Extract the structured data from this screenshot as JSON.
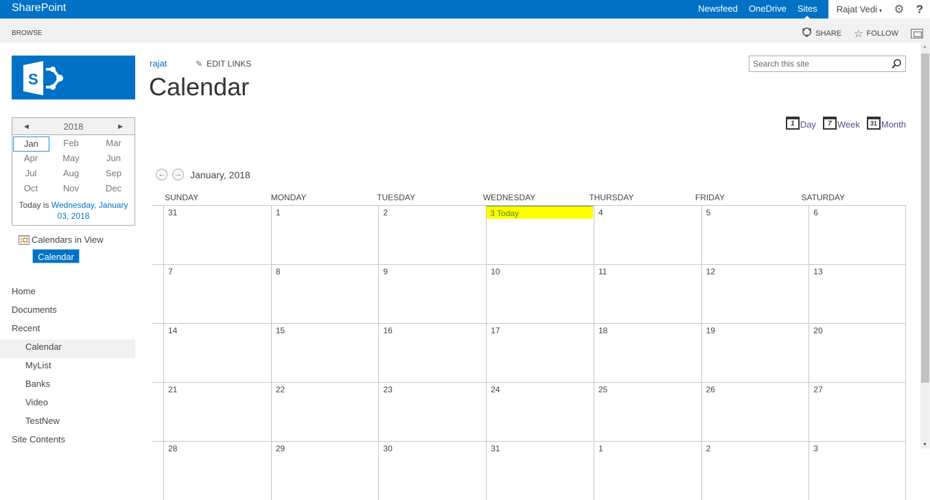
{
  "suitebar": {
    "brand": "SharePoint",
    "links": [
      {
        "label": "Newsfeed",
        "active": false
      },
      {
        "label": "OneDrive",
        "active": false
      },
      {
        "label": "Sites",
        "active": true
      }
    ],
    "user": "Rajat Vedi",
    "user_caret": "▾",
    "settings_icon": "⚙",
    "help_icon": "?"
  },
  "ribbon": {
    "tab": "BROWSE",
    "share_label": "SHARE",
    "follow_label": "FOLLOW"
  },
  "header": {
    "breadcrumb": "rajat",
    "edit_links": "EDIT LINKS",
    "title": "Calendar",
    "search_placeholder": "Search this site"
  },
  "views": [
    {
      "label": "Day",
      "icon_text": "1"
    },
    {
      "label": "Week",
      "icon_text": "7"
    },
    {
      "label": "Month",
      "icon_text": "31"
    }
  ],
  "datepicker": {
    "year": "2018",
    "prev_icon": "◀",
    "next_icon": "▶",
    "months": [
      "Jan",
      "Feb",
      "Mar",
      "Apr",
      "May",
      "Jun",
      "Jul",
      "Aug",
      "Sep",
      "Oct",
      "Nov",
      "Dec"
    ],
    "selected_month": "Jan",
    "today_prefix": "Today is ",
    "today_link": "Wednesday, January 03, 2018"
  },
  "calendars_in_view": {
    "label": "Calendars in View",
    "badge": "Calendar"
  },
  "quicklaunch": [
    {
      "label": "Home",
      "sub": false,
      "selected": false
    },
    {
      "label": "Documents",
      "sub": false,
      "selected": false
    },
    {
      "label": "Recent",
      "sub": false,
      "selected": false
    },
    {
      "label": "Calendar",
      "sub": true,
      "selected": true
    },
    {
      "label": "MyList",
      "sub": true,
      "selected": false
    },
    {
      "label": "Banks",
      "sub": true,
      "selected": false
    },
    {
      "label": "Video",
      "sub": true,
      "selected": false
    },
    {
      "label": "TestNew",
      "sub": true,
      "selected": false
    },
    {
      "label": "Site Contents",
      "sub": false,
      "selected": false
    }
  ],
  "calendar": {
    "month_label": "January, 2018",
    "prev_icon": "←",
    "next_icon": "→",
    "weekdays": [
      "SUNDAY",
      "MONDAY",
      "TUESDAY",
      "WEDNESDAY",
      "THURSDAY",
      "FRIDAY",
      "SATURDAY"
    ],
    "today_text": "3 Today",
    "weeks": [
      [
        "31",
        "1",
        "2",
        "3",
        "4",
        "5",
        "6"
      ],
      [
        "7",
        "8",
        "9",
        "10",
        "11",
        "12",
        "13"
      ],
      [
        "14",
        "15",
        "16",
        "17",
        "18",
        "19",
        "20"
      ],
      [
        "21",
        "22",
        "23",
        "24",
        "25",
        "26",
        "27"
      ],
      [
        "28",
        "29",
        "30",
        "31",
        "1",
        "2",
        "3"
      ]
    ],
    "today_week": 0,
    "today_day": 3,
    "today_highlight_color": "#ffff00"
  },
  "colors": {
    "brand": "#0072c6",
    "link": "#0072c6",
    "view_link": "#5d4a8a"
  }
}
